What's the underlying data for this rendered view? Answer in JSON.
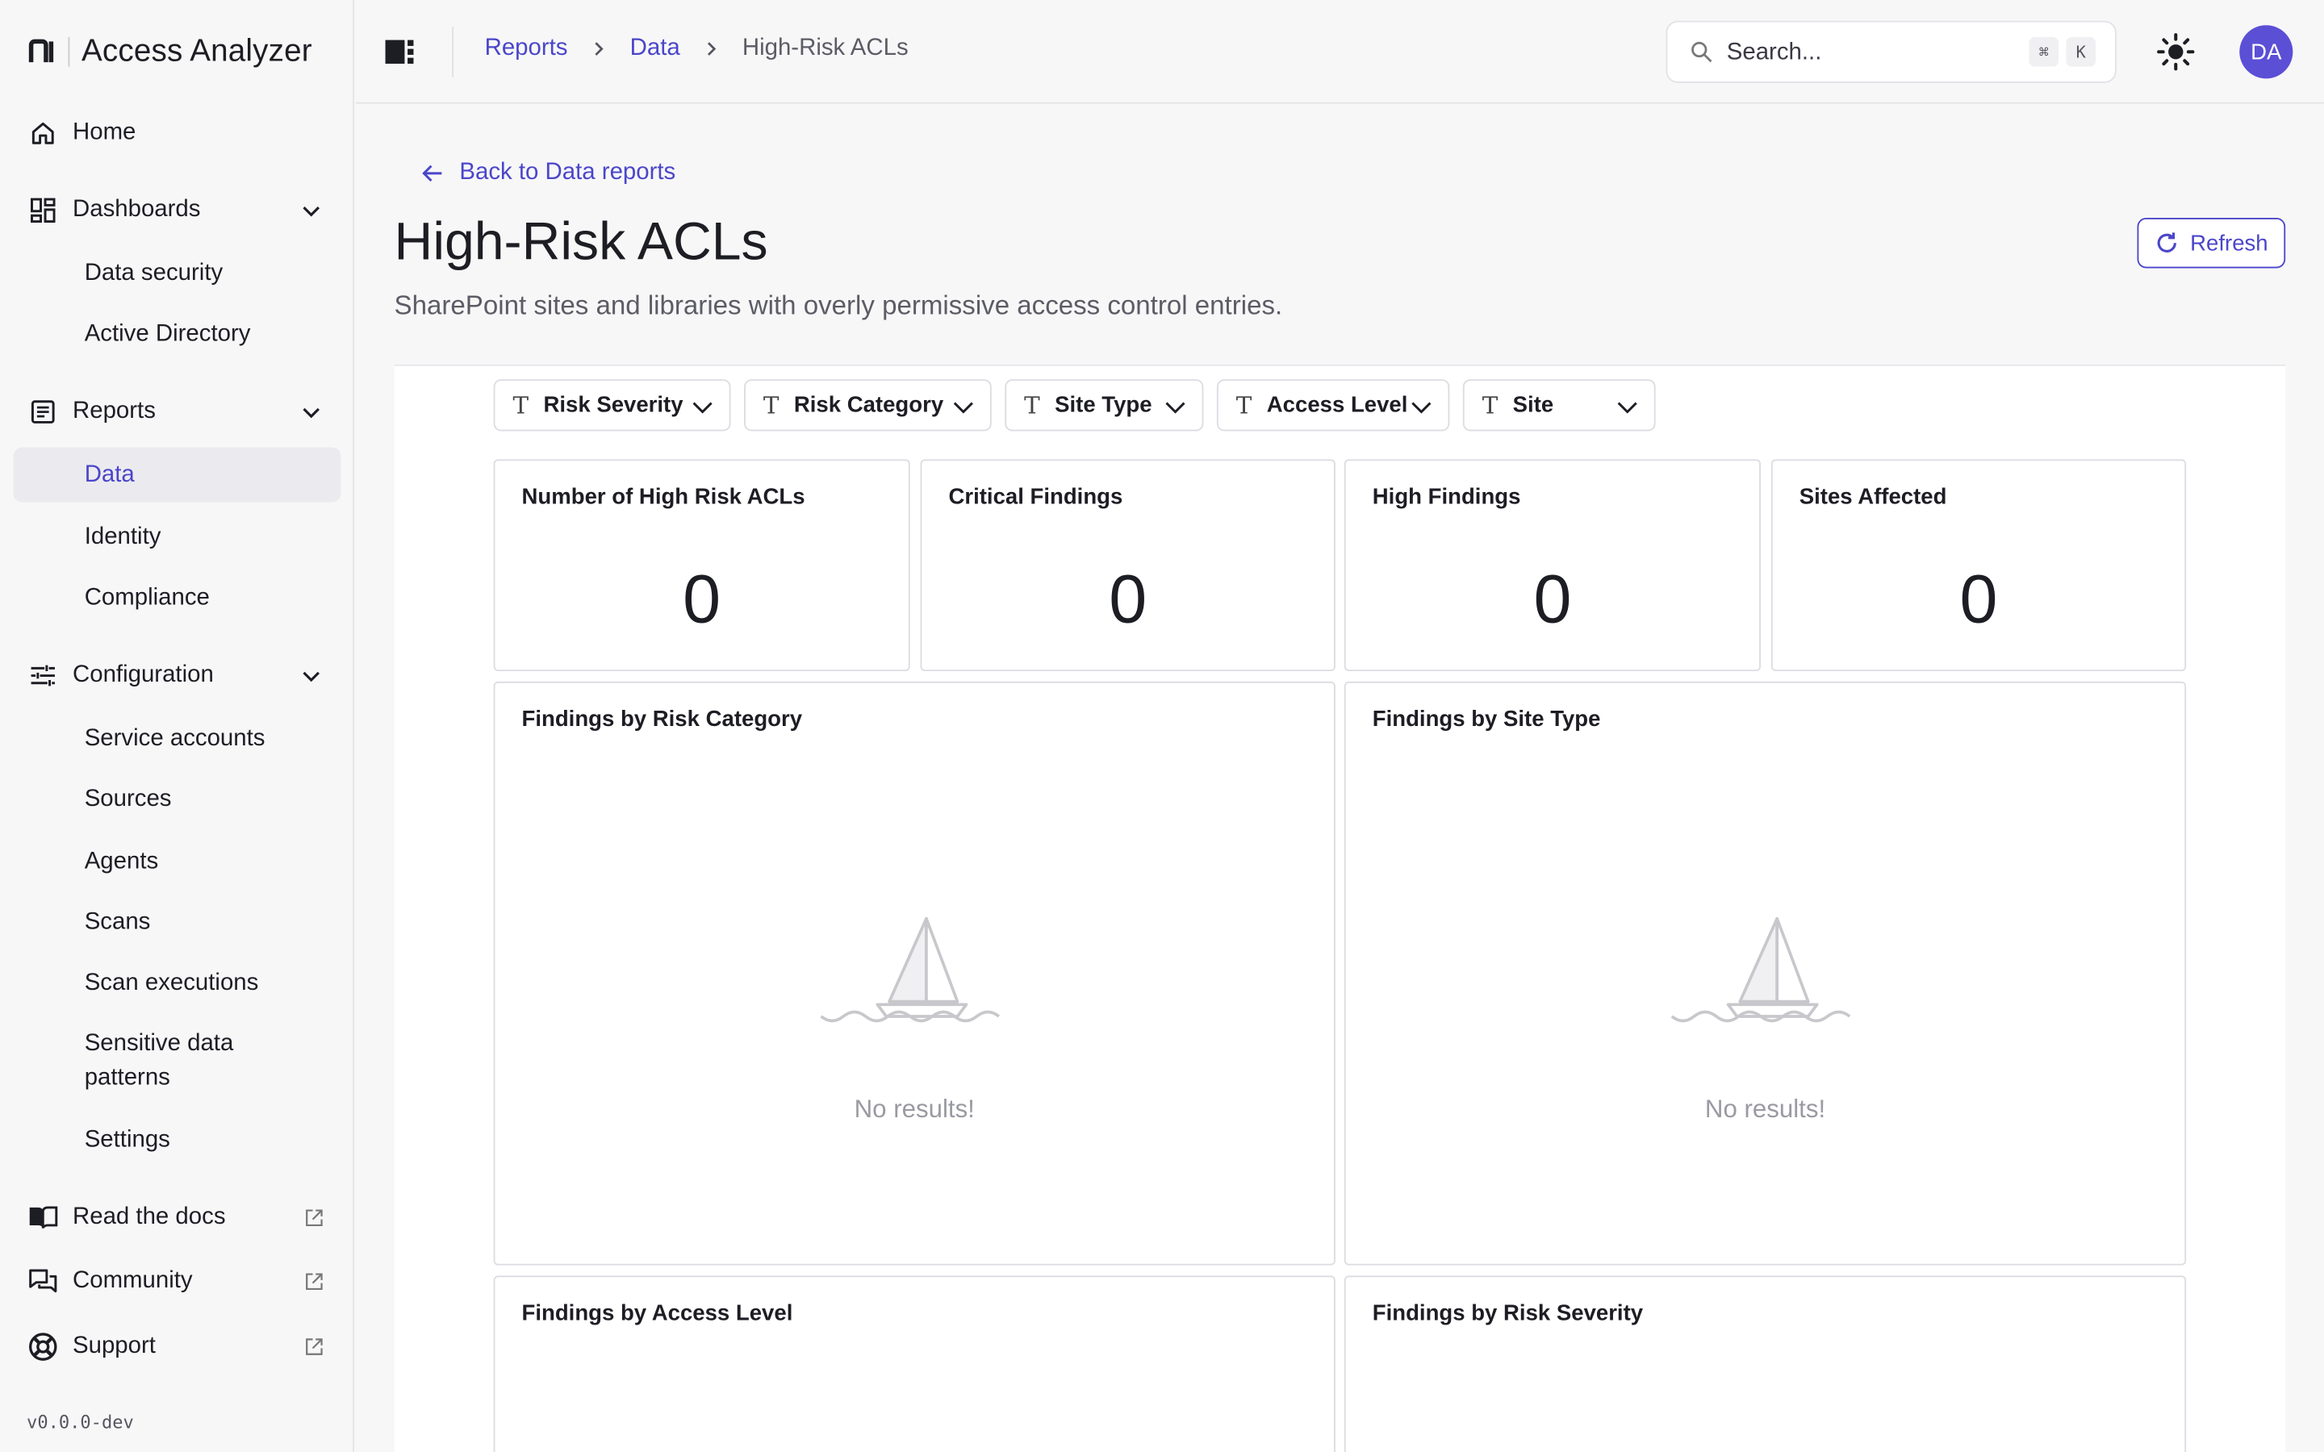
{
  "app": {
    "name": "Access Analyzer",
    "version": "v0.0.0-dev"
  },
  "sidebar": {
    "home": "Home",
    "dashboards": {
      "label": "Dashboards",
      "items": [
        "Data security",
        "Active Directory"
      ]
    },
    "reports": {
      "label": "Reports",
      "items": [
        "Data",
        "Identity",
        "Compliance"
      ],
      "active": "Data"
    },
    "configuration": {
      "label": "Configuration",
      "items": [
        "Service accounts",
        "Sources",
        "Agents",
        "Scans",
        "Scan executions",
        "Sensitive data patterns",
        "Settings"
      ]
    },
    "links": [
      "Read the docs",
      "Community",
      "Support"
    ]
  },
  "topbar": {
    "breadcrumb": [
      "Reports",
      "Data",
      "High-Risk ACLs"
    ],
    "search_placeholder": "Search...",
    "kbd": [
      "⌘",
      "K"
    ],
    "avatar": "DA"
  },
  "page": {
    "back_label": "Back to Data reports",
    "title": "High-Risk ACLs",
    "description": "SharePoint sites and libraries with overly permissive access control entries.",
    "refresh_label": "Refresh"
  },
  "filters": [
    "Risk Severity",
    "Risk Category",
    "Site Type",
    "Access Level",
    "Site"
  ],
  "kpis": [
    {
      "label": "Number of High Risk ACLs",
      "value": "0"
    },
    {
      "label": "Critical Findings",
      "value": "0"
    },
    {
      "label": "High Findings",
      "value": "0"
    },
    {
      "label": "Sites Affected",
      "value": "0"
    }
  ],
  "charts": [
    {
      "title": "Findings by Risk Category",
      "empty": "No results!"
    },
    {
      "title": "Findings by Site Type",
      "empty": "No results!"
    },
    {
      "title": "Findings by Access Level"
    },
    {
      "title": "Findings by Risk Severity"
    }
  ],
  "colors": {
    "accent": "#4b46c9",
    "avatar": "#5b4fd6",
    "muted": "#9a9aa2"
  }
}
